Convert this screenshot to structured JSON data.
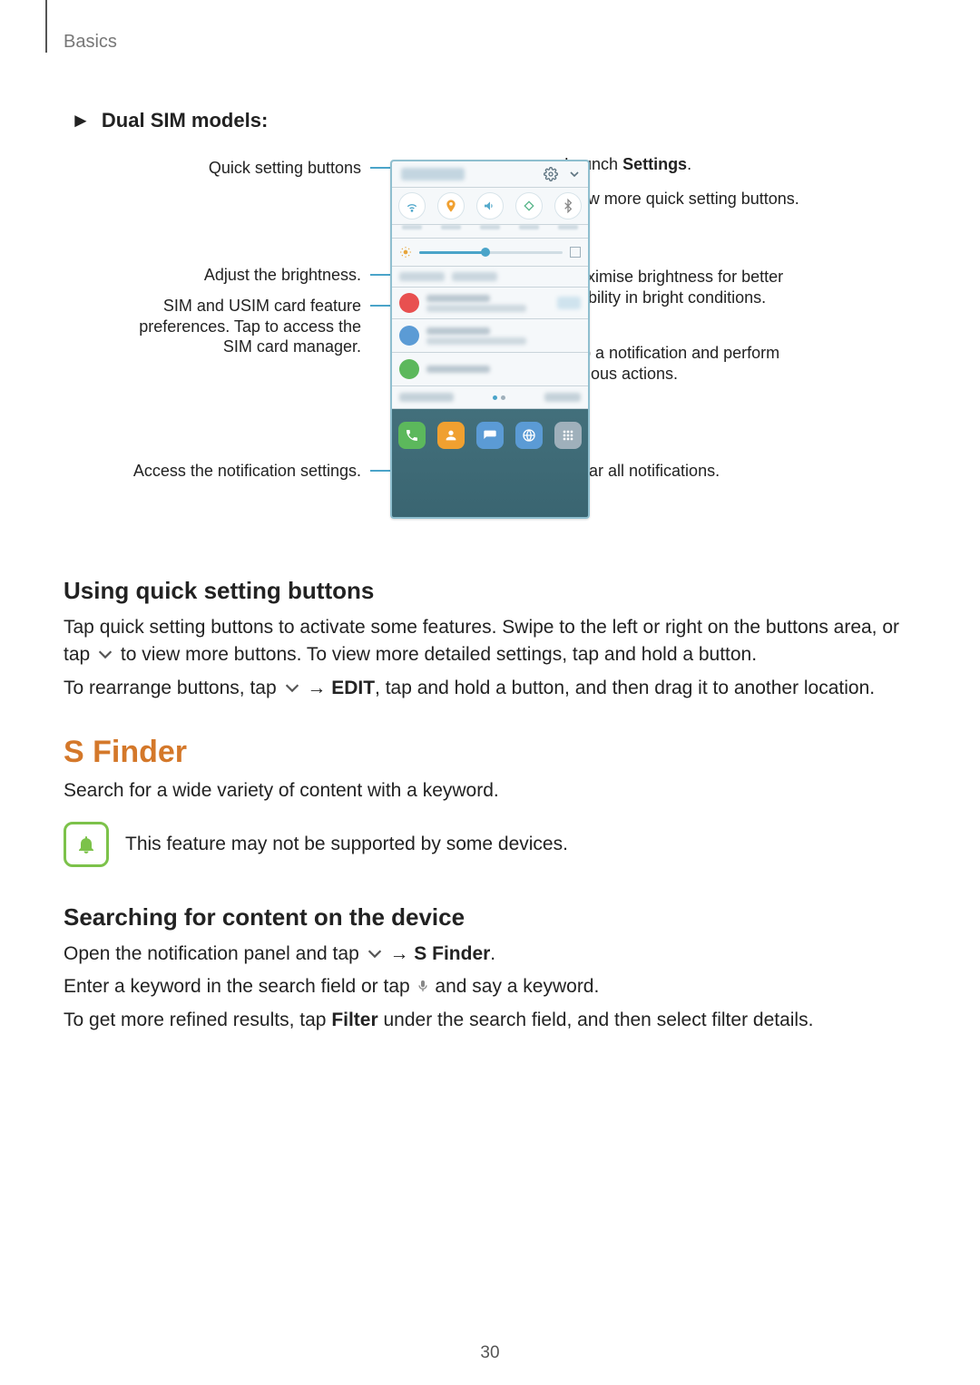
{
  "header": {
    "section": "Basics"
  },
  "subsection": {
    "marker": "►",
    "title": "Dual SIM models",
    "colon": ":"
  },
  "callouts": {
    "left": {
      "quick_settings": "Quick setting buttons",
      "brightness": "Adjust the brightness.",
      "sim": "SIM and USIM card feature preferences. Tap to access the SIM card manager.",
      "notif_settings": "Access the notification settings."
    },
    "right": {
      "settings_pre": "Launch ",
      "settings_bold": "Settings",
      "settings_post": ".",
      "more_qs": "View more quick setting buttons.",
      "max_bright": "Maximise brightness for better visibility in bright conditions.",
      "tap_notif": "Tap a notification and perform various actions.",
      "clear": "Clear all notifications."
    }
  },
  "quick_settings_section": {
    "heading": "Using quick setting buttons",
    "p1_a": "Tap quick setting buttons to activate some features. Swipe to the left or right on the buttons area, or tap ",
    "p1_b": " to view more buttons. To view more detailed settings, tap and hold a button.",
    "p2_a": "To rearrange buttons, tap ",
    "p2_arrow": " → ",
    "p2_edit": "EDIT",
    "p2_b": ", tap and hold a button, and then drag it to another location."
  },
  "sfinder": {
    "heading": "S Finder",
    "intro": "Search for a wide variety of content with a keyword.",
    "note": "This feature may not be supported by some devices.",
    "sub_heading": "Searching for content on the device",
    "p1_a": "Open the notification panel and tap ",
    "p1_arrow": " → ",
    "p1_bold": "S Finder",
    "p1_post": ".",
    "p2_a": "Enter a keyword in the search field or tap ",
    "p2_b": " and say a keyword.",
    "p3_a": "To get more refined results, tap ",
    "p3_bold": "Filter",
    "p3_b": " under the search field, and then select filter details."
  },
  "page_number": "30"
}
